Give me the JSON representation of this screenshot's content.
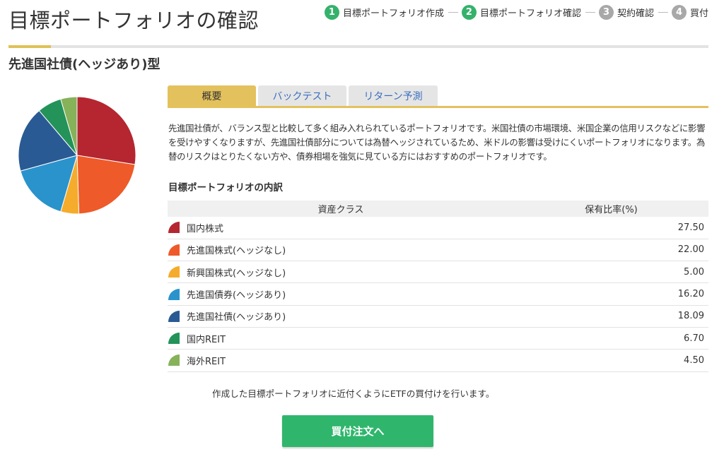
{
  "page": {
    "title": "目標ポートフォリオの確認",
    "portfolio_name": "先進国社債(ヘッジあり)型"
  },
  "steps": [
    {
      "number": "1",
      "label": "目標ポートフォリオ作成",
      "state": "done"
    },
    {
      "number": "2",
      "label": "目標ポートフォリオ確認",
      "state": "current"
    },
    {
      "number": "3",
      "label": "契約確認",
      "state": "pending"
    },
    {
      "number": "4",
      "label": "買付",
      "state": "pending"
    }
  ],
  "tabs": [
    {
      "label": "概要",
      "active": true
    },
    {
      "label": "バックテスト",
      "active": false
    },
    {
      "label": "リターン予測",
      "active": false
    }
  ],
  "description": "先進国社債が、バランス型と比較して多く組み入れられているポートフォリオです。米国社債の市場環境、米国企業の信用リスクなどに影響を受けやすくなりますが、先進国社債部分については為替ヘッジされているため、米ドルの影響は受けにくいポートフォリオになります。為替のリスクはとりたくない方や、債券相場を強気に見ている方にはおすすめのポートフォリオです。",
  "breakdown": {
    "title": "目標ポートフォリオの内訳",
    "col_class": "資産クラス",
    "col_ratio": "保有比率(%)",
    "rows": [
      {
        "name": "国内株式",
        "ratio": "27.50",
        "color": "#b52630"
      },
      {
        "name": "先進国株式(ヘッジなし)",
        "ratio": "22.00",
        "color": "#ee5a29"
      },
      {
        "name": "新興国株式(ヘッジなし)",
        "ratio": "5.00",
        "color": "#f5ac2c"
      },
      {
        "name": "先進国債券(ヘッジあり)",
        "ratio": "16.20",
        "color": "#2a93cc"
      },
      {
        "name": "先進国社債(ヘッジあり)",
        "ratio": "18.09",
        "color": "#2a5a93"
      },
      {
        "name": "国内REIT",
        "ratio": "6.70",
        "color": "#23935a"
      },
      {
        "name": "海外REIT",
        "ratio": "4.50",
        "color": "#86b25a"
      }
    ]
  },
  "chart_data": {
    "type": "pie",
    "categories": [
      "国内株式",
      "先進国株式(ヘッジなし)",
      "新興国株式(ヘッジなし)",
      "先進国債券(ヘッジあり)",
      "先進国社債(ヘッジあり)",
      "国内REIT",
      "海外REIT"
    ],
    "values": [
      27.5,
      22.0,
      5.0,
      16.2,
      18.09,
      6.7,
      4.5
    ],
    "colors": [
      "#b52630",
      "#ee5a29",
      "#f5ac2c",
      "#2a93cc",
      "#2a5a93",
      "#23935a",
      "#86b25a"
    ]
  },
  "etf_note": "作成した目標ポートフォリオに近付くようにETFの買付けを行います。",
  "buy_button_label": "買付注文へ"
}
